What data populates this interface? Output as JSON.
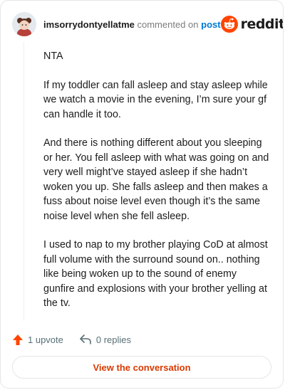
{
  "comment": {
    "username": "imsorrydontyellatme",
    "commented_on": "commented on",
    "post_link": "post",
    "brand": "reddit",
    "paragraphs": [
      "NTA",
      "If my toddler can fall asleep and stay asleep while we watch a movie in the evening, I’m sure your gf can handle it too.",
      "And there is nothing different about you sleeping or her. You fell asleep with what was going on and very well might’ve stayed asleep if she hadn’t woken you up. She falls asleep and then makes a fuss about noise level even though it’s the same noise level when she fell asleep.",
      "I used to nap to my brother playing CoD at almost full volume with the surround sound on.. nothing like being woken up to the sound of enemy gunfire and explosions with your brother yelling at the tv."
    ]
  },
  "actions": {
    "upvote_label": "1 upvote",
    "replies_label": "0 replies"
  },
  "footer": {
    "view_conversation_label": "View the conversation"
  },
  "colors": {
    "upvote": "#ff4500",
    "link": "#0079d3",
    "view_button_text": "#d93a00"
  },
  "icons": {
    "upvote": "upvote-arrow-icon",
    "reply": "reply-arrow-icon",
    "brand": "reddit-snoo-icon",
    "avatar": "user-avatar"
  }
}
